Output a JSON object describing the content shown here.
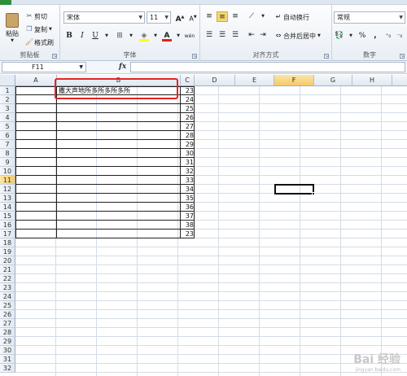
{
  "ribbon": {
    "clipboard": {
      "group_label": "剪贴板",
      "paste_label": "粘贴",
      "cut_label": "剪切",
      "copy_label": "复制",
      "format_painter_label": "格式刷"
    },
    "font": {
      "group_label": "字体",
      "font_name": "宋体",
      "font_size": "11",
      "grow_label": "A",
      "shrink_label": "A",
      "bold": "B",
      "italic": "I",
      "underline": "U",
      "font_color_label": "A",
      "phonetic_label": "wén"
    },
    "alignment": {
      "group_label": "对齐方式",
      "wrap_text_label": "自动换行",
      "merge_center_label": "合并后居中"
    },
    "number": {
      "group_label": "数字",
      "format_value": "常规",
      "percent_label": "%",
      "comma_label": ","
    }
  },
  "formula_bar": {
    "name_box": "F11",
    "fx_label": "fx",
    "formula": ""
  },
  "columns": [
    "A",
    "B",
    "C",
    "D",
    "E",
    "F",
    "G",
    "H"
  ],
  "active_column": "F",
  "active_row": "11",
  "rows": [
    "1",
    "2",
    "3",
    "4",
    "5",
    "6",
    "7",
    "8",
    "9",
    "10",
    "11",
    "12",
    "13",
    "14",
    "15",
    "16",
    "17",
    "18",
    "19",
    "20",
    "21",
    "22",
    "23",
    "24",
    "25",
    "26",
    "27",
    "28",
    "29",
    "30",
    "31",
    "32"
  ],
  "cells": {
    "B1": "撒大声地所多所多所多所",
    "C_values": [
      "23",
      "24",
      "25",
      "26",
      "27",
      "28",
      "29",
      "30",
      "31",
      "32",
      "33",
      "34",
      "35",
      "36",
      "37",
      "38",
      "23"
    ]
  },
  "accent_colors": {
    "highlight_box": "#e22525",
    "active_header": "#f4c96a"
  },
  "watermark": {
    "text": "Bai 经验",
    "subtext": "jingyan.baidu.com"
  }
}
